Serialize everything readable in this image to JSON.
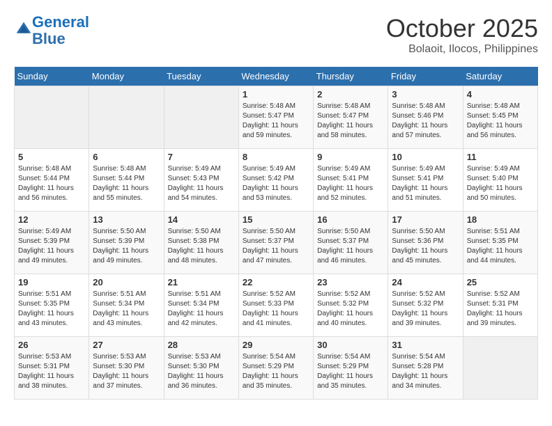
{
  "header": {
    "logo_line1": "General",
    "logo_line2": "Blue",
    "month": "October 2025",
    "location": "Bolaoit, Ilocos, Philippines"
  },
  "weekdays": [
    "Sunday",
    "Monday",
    "Tuesday",
    "Wednesday",
    "Thursday",
    "Friday",
    "Saturday"
  ],
  "weeks": [
    [
      {
        "day": "",
        "info": ""
      },
      {
        "day": "",
        "info": ""
      },
      {
        "day": "",
        "info": ""
      },
      {
        "day": "1",
        "info": "Sunrise: 5:48 AM\nSunset: 5:47 PM\nDaylight: 11 hours\nand 59 minutes."
      },
      {
        "day": "2",
        "info": "Sunrise: 5:48 AM\nSunset: 5:47 PM\nDaylight: 11 hours\nand 58 minutes."
      },
      {
        "day": "3",
        "info": "Sunrise: 5:48 AM\nSunset: 5:46 PM\nDaylight: 11 hours\nand 57 minutes."
      },
      {
        "day": "4",
        "info": "Sunrise: 5:48 AM\nSunset: 5:45 PM\nDaylight: 11 hours\nand 56 minutes."
      }
    ],
    [
      {
        "day": "5",
        "info": "Sunrise: 5:48 AM\nSunset: 5:44 PM\nDaylight: 11 hours\nand 56 minutes."
      },
      {
        "day": "6",
        "info": "Sunrise: 5:48 AM\nSunset: 5:44 PM\nDaylight: 11 hours\nand 55 minutes."
      },
      {
        "day": "7",
        "info": "Sunrise: 5:49 AM\nSunset: 5:43 PM\nDaylight: 11 hours\nand 54 minutes."
      },
      {
        "day": "8",
        "info": "Sunrise: 5:49 AM\nSunset: 5:42 PM\nDaylight: 11 hours\nand 53 minutes."
      },
      {
        "day": "9",
        "info": "Sunrise: 5:49 AM\nSunset: 5:41 PM\nDaylight: 11 hours\nand 52 minutes."
      },
      {
        "day": "10",
        "info": "Sunrise: 5:49 AM\nSunset: 5:41 PM\nDaylight: 11 hours\nand 51 minutes."
      },
      {
        "day": "11",
        "info": "Sunrise: 5:49 AM\nSunset: 5:40 PM\nDaylight: 11 hours\nand 50 minutes."
      }
    ],
    [
      {
        "day": "12",
        "info": "Sunrise: 5:49 AM\nSunset: 5:39 PM\nDaylight: 11 hours\nand 49 minutes."
      },
      {
        "day": "13",
        "info": "Sunrise: 5:50 AM\nSunset: 5:39 PM\nDaylight: 11 hours\nand 49 minutes."
      },
      {
        "day": "14",
        "info": "Sunrise: 5:50 AM\nSunset: 5:38 PM\nDaylight: 11 hours\nand 48 minutes."
      },
      {
        "day": "15",
        "info": "Sunrise: 5:50 AM\nSunset: 5:37 PM\nDaylight: 11 hours\nand 47 minutes."
      },
      {
        "day": "16",
        "info": "Sunrise: 5:50 AM\nSunset: 5:37 PM\nDaylight: 11 hours\nand 46 minutes."
      },
      {
        "day": "17",
        "info": "Sunrise: 5:50 AM\nSunset: 5:36 PM\nDaylight: 11 hours\nand 45 minutes."
      },
      {
        "day": "18",
        "info": "Sunrise: 5:51 AM\nSunset: 5:35 PM\nDaylight: 11 hours\nand 44 minutes."
      }
    ],
    [
      {
        "day": "19",
        "info": "Sunrise: 5:51 AM\nSunset: 5:35 PM\nDaylight: 11 hours\nand 43 minutes."
      },
      {
        "day": "20",
        "info": "Sunrise: 5:51 AM\nSunset: 5:34 PM\nDaylight: 11 hours\nand 43 minutes."
      },
      {
        "day": "21",
        "info": "Sunrise: 5:51 AM\nSunset: 5:34 PM\nDaylight: 11 hours\nand 42 minutes."
      },
      {
        "day": "22",
        "info": "Sunrise: 5:52 AM\nSunset: 5:33 PM\nDaylight: 11 hours\nand 41 minutes."
      },
      {
        "day": "23",
        "info": "Sunrise: 5:52 AM\nSunset: 5:32 PM\nDaylight: 11 hours\nand 40 minutes."
      },
      {
        "day": "24",
        "info": "Sunrise: 5:52 AM\nSunset: 5:32 PM\nDaylight: 11 hours\nand 39 minutes."
      },
      {
        "day": "25",
        "info": "Sunrise: 5:52 AM\nSunset: 5:31 PM\nDaylight: 11 hours\nand 39 minutes."
      }
    ],
    [
      {
        "day": "26",
        "info": "Sunrise: 5:53 AM\nSunset: 5:31 PM\nDaylight: 11 hours\nand 38 minutes."
      },
      {
        "day": "27",
        "info": "Sunrise: 5:53 AM\nSunset: 5:30 PM\nDaylight: 11 hours\nand 37 minutes."
      },
      {
        "day": "28",
        "info": "Sunrise: 5:53 AM\nSunset: 5:30 PM\nDaylight: 11 hours\nand 36 minutes."
      },
      {
        "day": "29",
        "info": "Sunrise: 5:54 AM\nSunset: 5:29 PM\nDaylight: 11 hours\nand 35 minutes."
      },
      {
        "day": "30",
        "info": "Sunrise: 5:54 AM\nSunset: 5:29 PM\nDaylight: 11 hours\nand 35 minutes."
      },
      {
        "day": "31",
        "info": "Sunrise: 5:54 AM\nSunset: 5:28 PM\nDaylight: 11 hours\nand 34 minutes."
      },
      {
        "day": "",
        "info": ""
      }
    ]
  ]
}
